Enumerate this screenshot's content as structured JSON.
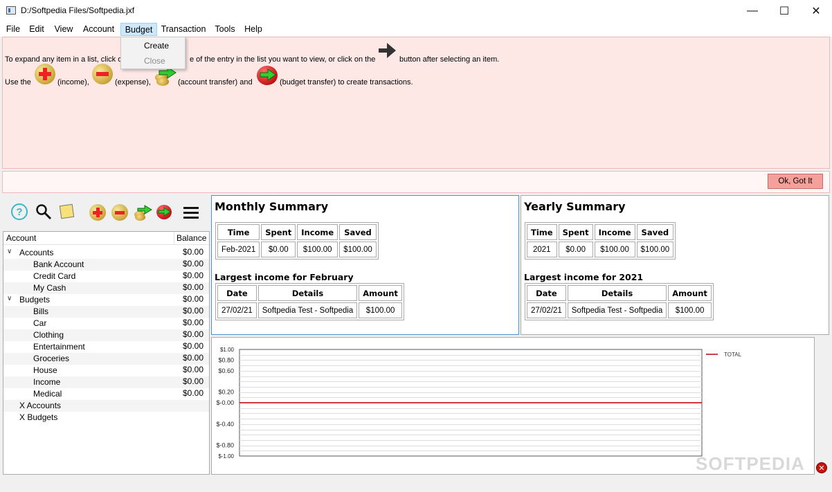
{
  "window": {
    "title": "D:/Softpedia Files/Softpedia.jxf",
    "minimize": "—",
    "maximize": "☐",
    "close": "✕"
  },
  "menu": [
    "File",
    "Edit",
    "View",
    "Account",
    "Budget",
    "Transaction",
    "Tools",
    "Help"
  ],
  "budget_menu": {
    "create": "Create",
    "close": "Close"
  },
  "info": {
    "line1_a": "To expand any item in a list, click o",
    "line1_b": "e of the entry in the list you want to view, or click on the",
    "line1_c": "button after selecting an item.",
    "line2_a": "Use the",
    "line2_income": "(income),",
    "line2_expense": "(expense),",
    "line2_transfer": "(account transfer) and",
    "line2_budget": "(budget transfer) to create transactions."
  },
  "ok_button": "Ok, Got It",
  "toolbar": [
    "help-icon",
    "search-icon",
    "note-icon",
    "add-income-icon",
    "add-expense-icon",
    "account-transfer-icon",
    "budget-transfer-icon",
    "menu-icon"
  ],
  "tree": {
    "header_account": "Account",
    "header_balance": "Balance",
    "accounts_label": "Accounts",
    "accounts": [
      {
        "name": "Bank Account",
        "balance": "$0.00"
      },
      {
        "name": "Credit Card",
        "balance": "$0.00"
      },
      {
        "name": "My Cash",
        "balance": "$0.00"
      }
    ],
    "accounts_balance": "$0.00",
    "budgets_label": "Budgets",
    "budgets_balance": "$0.00",
    "budgets": [
      {
        "name": "Bills",
        "balance": "$0.00"
      },
      {
        "name": "Car",
        "balance": "$0.00"
      },
      {
        "name": "Clothing",
        "balance": "$0.00"
      },
      {
        "name": "Entertainment",
        "balance": "$0.00"
      },
      {
        "name": "Groceries",
        "balance": "$0.00"
      },
      {
        "name": "House",
        "balance": "$0.00"
      },
      {
        "name": "Income",
        "balance": "$0.00"
      },
      {
        "name": "Medical",
        "balance": "$0.00"
      }
    ],
    "x_accounts": "X Accounts",
    "x_budgets": "X Budgets"
  },
  "monthly": {
    "title": "Monthly Summary",
    "headers": [
      "Time",
      "Spent",
      "Income",
      "Saved"
    ],
    "row": [
      "Feb-2021",
      "$0.00",
      "$100.00",
      "$100.00"
    ],
    "largest_title": "Largest income for February",
    "largest_headers": [
      "Date",
      "Details",
      "Amount"
    ],
    "largest_row": [
      "27/02/21",
      "Softpedia Test - Softpedia",
      "$100.00"
    ]
  },
  "yearly": {
    "title": "Yearly Summary",
    "headers": [
      "Time",
      "Spent",
      "Income",
      "Saved"
    ],
    "row": [
      "2021",
      "$0.00",
      "$100.00",
      "$100.00"
    ],
    "largest_title": "Largest income for 2021",
    "largest_headers": [
      "Date",
      "Details",
      "Amount"
    ],
    "largest_row": [
      "27/02/21",
      "Softpedia Test - Softpedia",
      "$100.00"
    ]
  },
  "chart_data": {
    "type": "line",
    "title": "",
    "xlabel": "",
    "ylabel": "",
    "ylim": [
      -1.0,
      1.0
    ],
    "y_tick_labels": [
      "$1.00",
      "$0.80",
      "$0.60",
      "$0.20",
      "$-0.00",
      "$-0.40",
      "$-0.80",
      "$-1.00"
    ],
    "y_tick_values": [
      1.0,
      0.8,
      0.6,
      0.2,
      0.0,
      -0.4,
      -0.8,
      -1.0
    ],
    "grid": true,
    "legend_position": "top-right",
    "series": [
      {
        "name": "TOTAL",
        "color": "#c00000",
        "values": [
          0,
          0
        ]
      }
    ]
  },
  "watermark": "SOFTPEDIA"
}
